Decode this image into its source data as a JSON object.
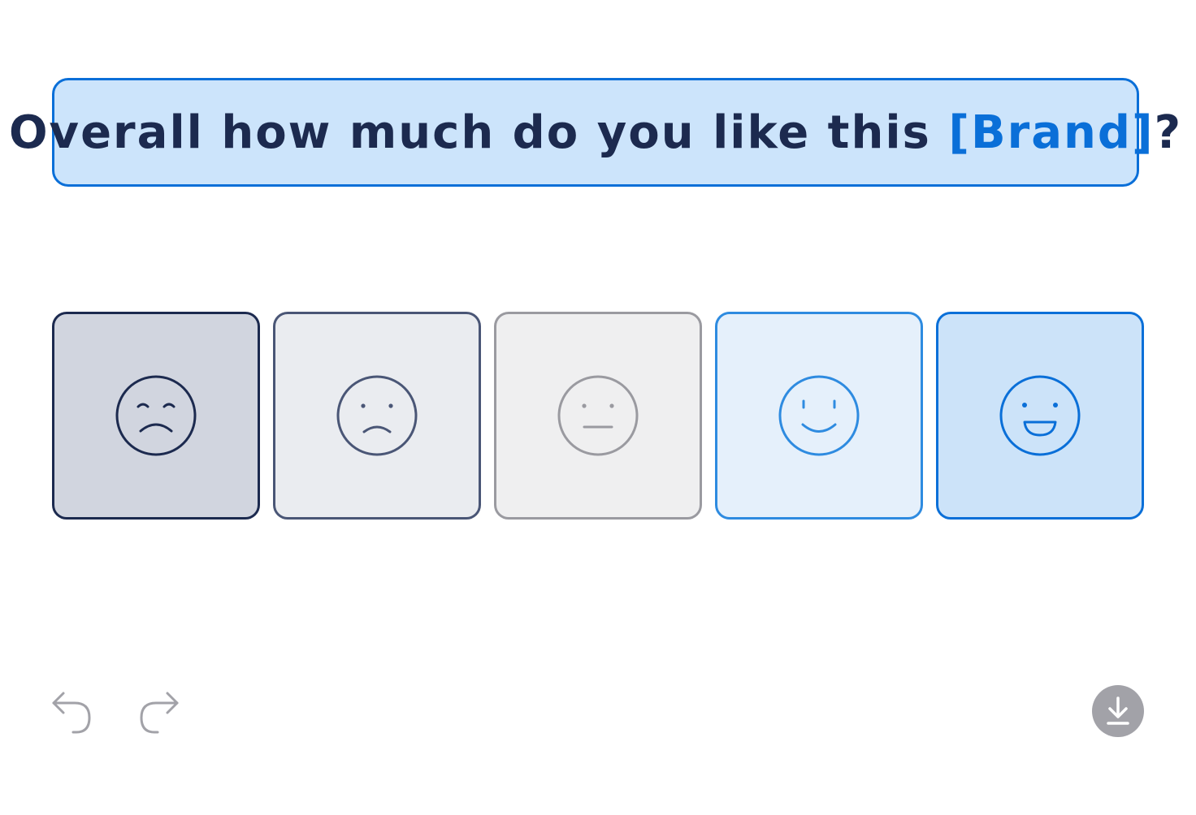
{
  "question": {
    "prefix": "Overall how much do you like this ",
    "highlight": "[Brand]",
    "suffix": "?"
  },
  "rating_options": [
    {
      "icon": "very-unhappy-face-icon",
      "bg": "#d1d5df",
      "border": "#1c2a4f",
      "stroke": "#1c2a4f"
    },
    {
      "icon": "unhappy-face-icon",
      "bg": "#eaecf0",
      "border": "#4a5676",
      "stroke": "#4a5676"
    },
    {
      "icon": "neutral-face-icon",
      "bg": "#efeff0",
      "border": "#9a9aa0",
      "stroke": "#9a9aa0"
    },
    {
      "icon": "happy-face-icon",
      "bg": "#e5f0fb",
      "border": "#2e8be0",
      "stroke": "#2e8be0"
    },
    {
      "icon": "very-happy-face-icon",
      "bg": "#cce3f9",
      "border": "#0a6fd8",
      "stroke": "#0a6fd8"
    }
  ],
  "toolbar": {
    "undo_icon": "undo-icon",
    "redo_icon": "redo-icon",
    "download_icon": "download-icon",
    "icon_color": "#a2a2a8",
    "download_bg": "#a2a2a8"
  },
  "colors": {
    "accent": "#0a6fd8",
    "text": "#1c2a4f",
    "question_bg": "#cce4fb"
  }
}
